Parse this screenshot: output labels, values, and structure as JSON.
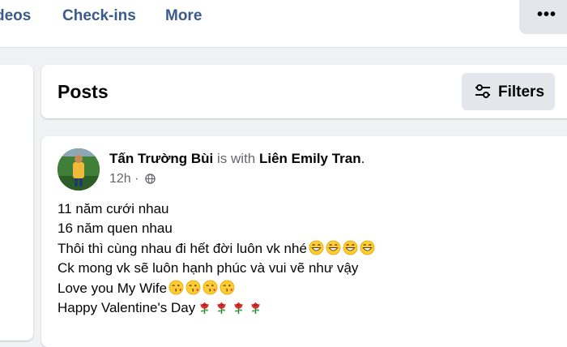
{
  "tabs": [
    {
      "label": "Videos",
      "visible_text": "deos"
    },
    {
      "label": "Check-ins"
    },
    {
      "label": "More"
    }
  ],
  "more_button": {
    "icon": "ellipsis-icon",
    "label": "•••"
  },
  "posts_header": {
    "title": "Posts",
    "filters_label": "Filters",
    "filters_icon": "sliders-icon"
  },
  "post": {
    "author": "Tấn Trường Bùi",
    "with_text": "is with",
    "tagged": "Liên Emily Tran",
    "time": "12h ·",
    "privacy_icon": "globe-icon",
    "lines": [
      {
        "text": "11 năm cưới nhau",
        "emoji": "",
        "emoji_count": 0
      },
      {
        "text": "16 năm quen nhau",
        "emoji": "",
        "emoji_count": 0
      },
      {
        "text": "Thôi thì cùng nhau đi hết đời luôn vk nhé",
        "emoji": "grinning-face",
        "emoji_count": 4
      },
      {
        "text": "Ck mong vk sẽ luôn hạnh phúc và vui vẽ như vậy",
        "emoji": "",
        "emoji_count": 0
      },
      {
        "text": "Love you My Wife",
        "emoji": "kissing-face",
        "emoji_count": 4
      },
      {
        "text": "Happy Valentine's Day",
        "emoji": "rose",
        "emoji_count": 4
      }
    ]
  },
  "colors": {
    "tab_text": "#3a5a8c",
    "page_bg": "#f0f2f5",
    "button_bg": "#e4e6eb",
    "secondary_text": "#65676b"
  }
}
